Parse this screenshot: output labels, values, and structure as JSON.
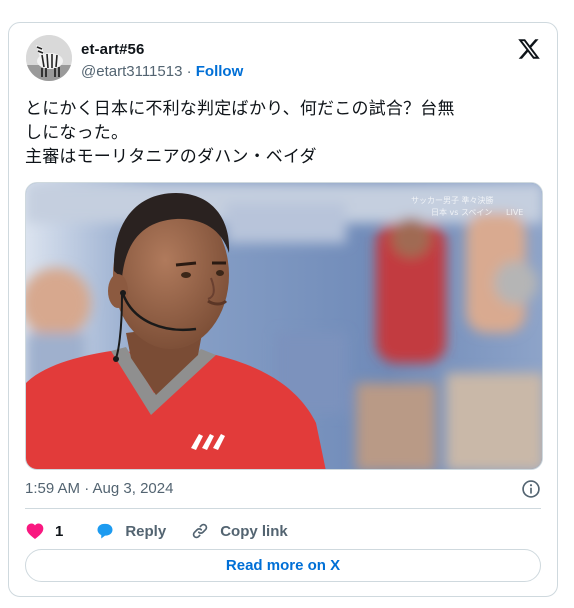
{
  "author": {
    "display_name": "et-art#56",
    "handle": "@etart3111513",
    "separator": " · ",
    "follow_label": "Follow",
    "avatar_icon": "zebra-avatar"
  },
  "tweet": {
    "text": "とにかく日本に不利な判定ばかり、何だこの試合？台無\nしになった。\n主審はモーリタニアのダハン・ベイダ",
    "timestamp": "1:59 AM · Aug 3, 2024"
  },
  "media": {
    "overlay_line1": "サッカー男子 準々決勝",
    "overlay_line2": "日本 vs スペイン",
    "overlay_badge": "LIVE"
  },
  "actions": {
    "like_count": "1",
    "reply_label": "Reply",
    "copy_label": "Copy link"
  },
  "footer": {
    "read_more_label": "Read more on X"
  },
  "colors": {
    "accent": "#006fd6",
    "like": "#f91880",
    "reply": "#1d9bf0",
    "secondary_text": "#536471",
    "border": "#cfd9de"
  },
  "icons": [
    "x-logo-icon",
    "info-icon",
    "heart-icon",
    "reply-bubble-icon",
    "link-icon"
  ]
}
